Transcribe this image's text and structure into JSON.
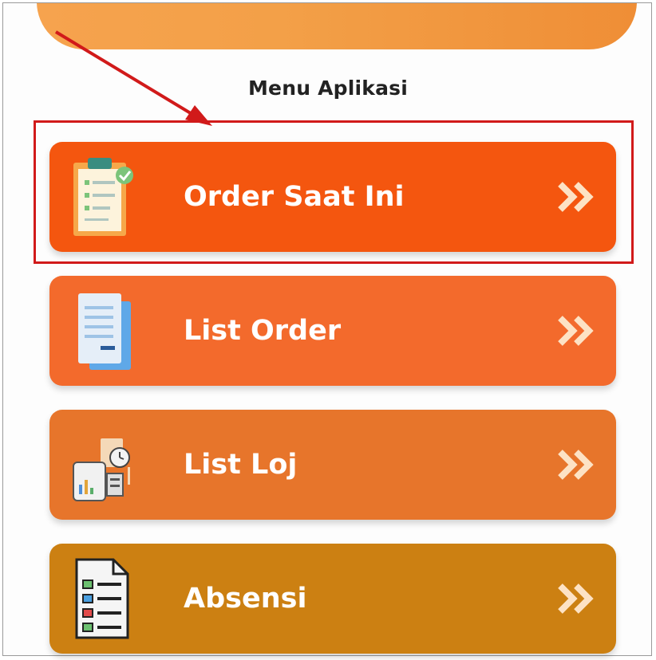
{
  "title": "Menu Aplikasi",
  "menu": [
    {
      "label": "Order Saat Ini",
      "icon": "clipboard-check-icon",
      "color": "#f4560f"
    },
    {
      "label": "List Order",
      "icon": "document-list-icon",
      "color": "#f36a2c"
    },
    {
      "label": "List Loj",
      "icon": "reports-clock-icon",
      "color": "#e7752b"
    },
    {
      "label": "Absensi",
      "icon": "attendance-checklist-icon",
      "color": "#cc8012"
    }
  ],
  "chevron_icon": "double-chevron-right-icon",
  "annotation": {
    "color": "#d11a1a"
  }
}
